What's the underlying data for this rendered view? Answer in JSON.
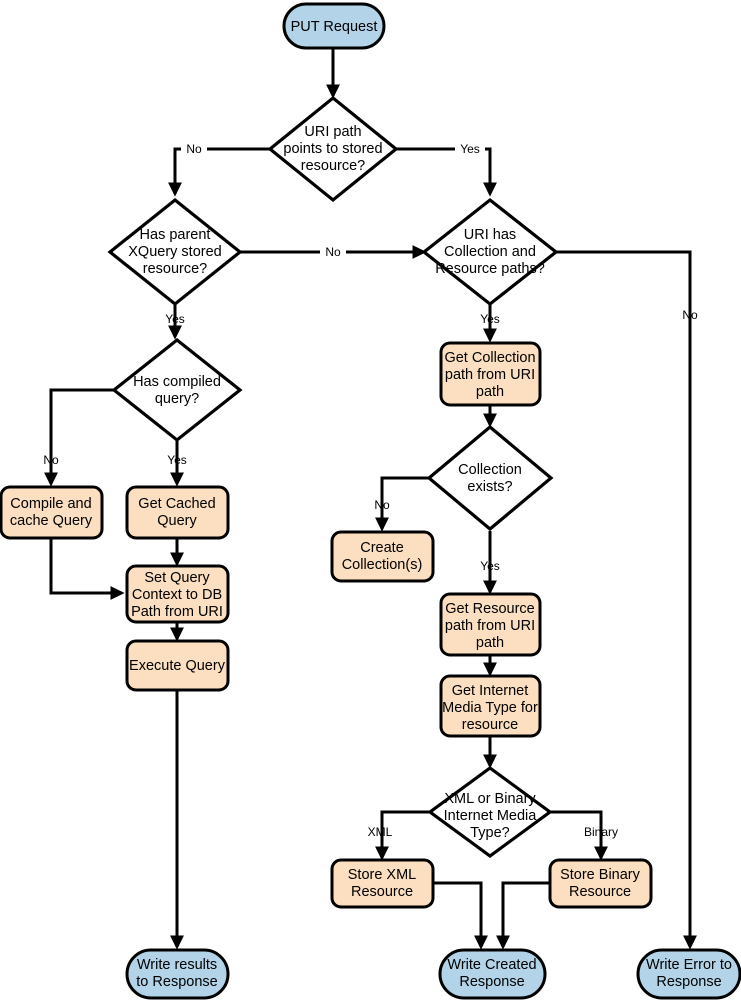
{
  "diagram": {
    "title": "PUT Request processing flowchart",
    "colors": {
      "terminal_fill": "#b3d4e8",
      "process_fill": "#fbdfc0",
      "decision_fill": "#ffffff",
      "stroke": "#000000",
      "background": "#ffffff"
    },
    "nodes": [
      {
        "id": "put_request",
        "type": "terminal",
        "lines": [
          "PUT Request"
        ]
      },
      {
        "id": "uri_points",
        "type": "decision",
        "lines": [
          "URI path",
          "points to stored",
          "resource?"
        ]
      },
      {
        "id": "has_parent",
        "type": "decision",
        "lines": [
          "Has parent",
          "XQuery stored",
          "resource?"
        ]
      },
      {
        "id": "uri_has_coll",
        "type": "decision",
        "lines": [
          "URI has",
          "Collection and",
          "Resource paths?"
        ]
      },
      {
        "id": "has_compiled",
        "type": "decision",
        "lines": [
          "Has compiled",
          "query?"
        ]
      },
      {
        "id": "compile_cache",
        "type": "process",
        "lines": [
          "Compile and",
          "cache Query"
        ]
      },
      {
        "id": "get_cached",
        "type": "process",
        "lines": [
          "Get Cached",
          "Query"
        ]
      },
      {
        "id": "set_query_ctx",
        "type": "process",
        "lines": [
          "Set Query",
          "Context to DB",
          "Path from URI"
        ]
      },
      {
        "id": "execute_query",
        "type": "process",
        "lines": [
          "Execute Query"
        ]
      },
      {
        "id": "get_collection",
        "type": "process",
        "lines": [
          "Get Collection",
          "path from URI",
          "path"
        ]
      },
      {
        "id": "collection_exists",
        "type": "decision",
        "lines": [
          "Collection",
          "exists?"
        ]
      },
      {
        "id": "create_collection",
        "type": "process",
        "lines": [
          "Create",
          "Collection(s)"
        ]
      },
      {
        "id": "get_resource",
        "type": "process",
        "lines": [
          "Get Resource",
          "path from URI",
          "path"
        ]
      },
      {
        "id": "get_media_type",
        "type": "process",
        "lines": [
          "Get Internet",
          "Media Type for",
          "resource"
        ]
      },
      {
        "id": "xml_or_binary",
        "type": "decision",
        "lines": [
          "XML or Binary",
          "Internet Media",
          "Type?"
        ]
      },
      {
        "id": "store_xml",
        "type": "process",
        "lines": [
          "Store XML",
          "Resource"
        ]
      },
      {
        "id": "store_binary",
        "type": "process",
        "lines": [
          "Store Binary",
          "Resource"
        ]
      },
      {
        "id": "write_results",
        "type": "terminal",
        "lines": [
          "Write results",
          "to Response"
        ]
      },
      {
        "id": "write_created",
        "type": "terminal",
        "lines": [
          "Write Created",
          "Response"
        ]
      },
      {
        "id": "write_error",
        "type": "terminal",
        "lines": [
          "Write Error to",
          "Response"
        ]
      }
    ],
    "edge_labels": [
      {
        "id": "uri_points_no",
        "text": "No"
      },
      {
        "id": "uri_points_yes",
        "text": "Yes"
      },
      {
        "id": "has_parent_no",
        "text": "No"
      },
      {
        "id": "has_parent_yes",
        "text": "Yes"
      },
      {
        "id": "uri_has_coll_yes",
        "text": "Yes"
      },
      {
        "id": "uri_has_coll_no",
        "text": "No"
      },
      {
        "id": "has_compiled_no",
        "text": "No"
      },
      {
        "id": "has_compiled_yes",
        "text": "Yes"
      },
      {
        "id": "collection_exists_no",
        "text": "No"
      },
      {
        "id": "collection_exists_yes",
        "text": "Yes"
      },
      {
        "id": "xml_branch",
        "text": "XML"
      },
      {
        "id": "binary_branch",
        "text": "Binary"
      }
    ]
  }
}
